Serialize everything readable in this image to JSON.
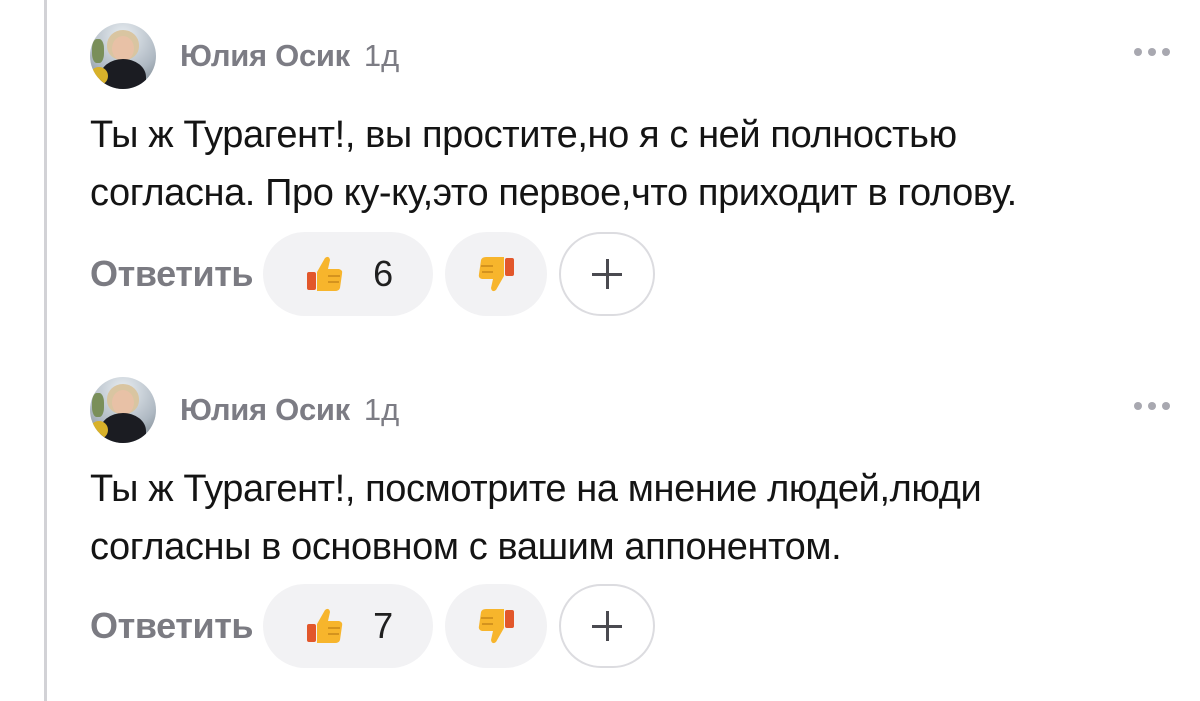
{
  "comments": [
    {
      "author": "Юлия Осик",
      "time": "1д",
      "text_lines": [
        "Ты ж Турагент!, вы простите,но я с ней полностью",
        "согласна. Про ку-ку,это первое,что приходит в голову."
      ],
      "reply_label": "Ответить",
      "like_count": "6",
      "icons": {
        "like": "thumbs-up-icon",
        "dislike": "thumbs-down-icon",
        "add": "plus-icon",
        "more": "more-dots-icon"
      }
    },
    {
      "author": "Юлия Осик",
      "time": "1д",
      "text_lines": [
        "Ты ж Турагент!, посмотрите на мнение людей,люди",
        "согласны в основном с вашим аппонентом."
      ],
      "reply_label": "Ответить",
      "like_count": "7",
      "icons": {
        "like": "thumbs-up-icon",
        "dislike": "thumbs-down-icon",
        "add": "plus-icon",
        "more": "more-dots-icon"
      }
    }
  ],
  "colors": {
    "thread_line": "#d2d2d6",
    "meta_text": "#7c7c84",
    "pill_bg": "#f2f2f4",
    "emoji_yellow": "#f7b52c",
    "emoji_cuff": "#e2572b"
  }
}
